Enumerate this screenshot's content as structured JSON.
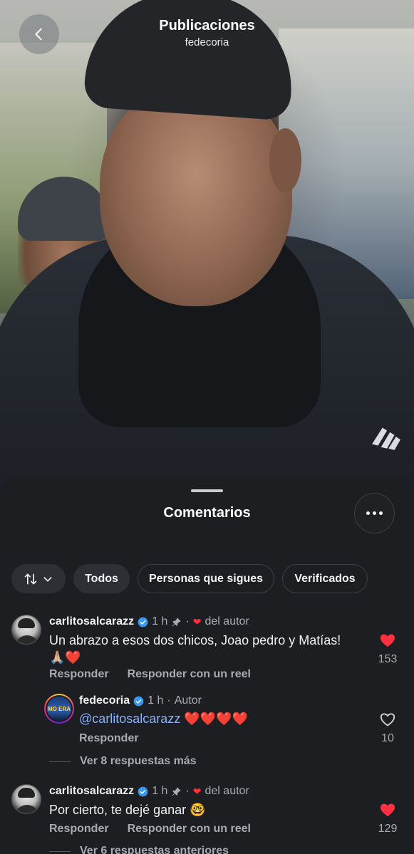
{
  "header": {
    "title": "Publicaciones",
    "subtitle": "fedecoria"
  },
  "sheet": {
    "title": "Comentarios"
  },
  "filters": {
    "all": "Todos",
    "following": "Personas que sigues",
    "verified": "Verificados"
  },
  "comments": [
    {
      "user": "carlitosalcarazz",
      "time": "1 h",
      "by_author": "del autor",
      "text": "Un abrazo a esos dos chicos, Joao pedro y Matías!",
      "emoji_line": "🙏🏼❤️",
      "reply_label": "Responder",
      "reel_label": "Responder con un reel",
      "likes": "153",
      "liked": true
    },
    {
      "user": "fedecoria",
      "time": "1 h",
      "author_tag": "Autor",
      "mention": "@carlitosalcarazz",
      "text": "❤️❤️❤️❤️",
      "reply_label": "Responder",
      "likes": "10",
      "liked": false,
      "avatar_text": "MO  ERA"
    },
    {
      "user": "carlitosalcarazz",
      "time": "1 h",
      "by_author": "del autor",
      "text": "Por cierto, te dejé ganar 🤓",
      "reply_label": "Responder",
      "reel_label": "Responder con un reel",
      "likes": "129",
      "liked": true
    }
  ],
  "more_replies_1": "Ver 8 respuestas más",
  "more_replies_2": "Ver 6 respuestas anteriores",
  "colors": {
    "sheet_bg": "#1c1e22",
    "like_red": "#ff3040",
    "verified_blue": "#3897f0",
    "mention_blue": "#8eb1ff"
  }
}
